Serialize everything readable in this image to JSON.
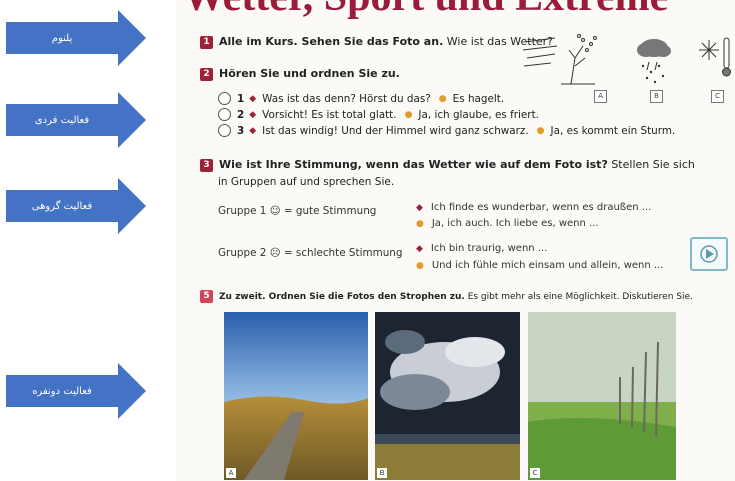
{
  "side_labels": [
    "پلنوم",
    "فعالیت فردی",
    "فعالیت گروهی",
    "فعالیت دونفره"
  ],
  "title": "Wetter, Sport und Extreme",
  "task1": {
    "number": "1",
    "bold": "Alle im Kurs. Sehen Sie das Foto an.",
    "normal": "Wie ist das Wetter?"
  },
  "icon_captions": [
    "A",
    "B",
    "C"
  ],
  "task2": {
    "number": "2",
    "heading": "Hören Sie und ordnen Sie zu.",
    "items": [
      {
        "n": "1",
        "q": "Was ist das denn? Hörst du das?",
        "a": "Es hagelt."
      },
      {
        "n": "2",
        "q": "Vorsicht! Es ist total glatt.",
        "a": "Ja, ich glaube, es friert."
      },
      {
        "n": "3",
        "q": "Ist das windig! Und der Himmel wird ganz schwarz.",
        "a": "Ja, es kommt ein Sturm."
      }
    ]
  },
  "task3": {
    "number": "3",
    "bold": "Wie ist Ihre Stimmung, wenn das Wetter wie auf dem Foto ist?",
    "normal": "Stellen Sie sich",
    "line2": "in Gruppen auf und sprechen Sie.",
    "group1": {
      "label": "Gruppe 1 ☺ = gute Stimmung",
      "r1": "Ich finde es wunderbar, wenn es draußen ...",
      "r2": "Ja, ich auch. Ich liebe es, wenn ..."
    },
    "group2": {
      "label": "Gruppe 2 ☹ = schlechte Stimmung",
      "r1": "Ich bin traurig, wenn ...",
      "r2": "Und ich fühle mich einsam und allein, wenn ..."
    }
  },
  "task5": {
    "number": "5",
    "bold": "Zu zweit. Ordnen Sie die Fotos den Strophen zu.",
    "normal": "Es gibt mehr als eine Möglichkeit. Diskutieren Sie."
  },
  "photo_labels": [
    "A",
    "B",
    "C"
  ]
}
